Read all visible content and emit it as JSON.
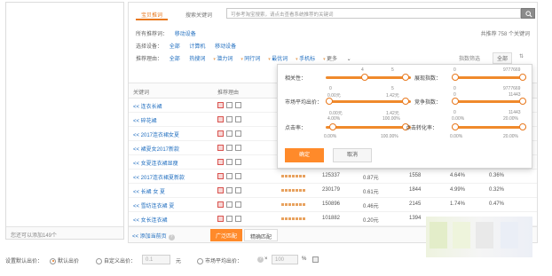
{
  "left_panel": {
    "footer": "您还可以添加149个"
  },
  "tabs": [
    {
      "label": "宝贝推词",
      "active": true
    },
    {
      "label": "搜索关键词",
      "active": false
    }
  ],
  "search": {
    "placeholder": "可参考淘宝搜索，请点击查看系统推荐的关键词"
  },
  "filters": {
    "recommend_label": "所有推荐词：",
    "recommend_items": [
      "移动设备"
    ],
    "device_label": "选择设备：",
    "device_items": [
      "全部",
      "计算机",
      "移动设备"
    ],
    "reason_label": "推荐理由：",
    "reason_items": [
      "全部",
      "热搜词",
      "潜力词",
      "同行词",
      "最优词",
      "手机标"
    ],
    "more": "更多",
    "index_filter": "指数筛选",
    "all": "全部"
  },
  "total_text": "共推荐 758 个关键词",
  "table": {
    "headers": [
      "关键词",
      "推荐理由"
    ],
    "rows": [
      {
        "kw": "<< 连衣长裙",
        "c1": "",
        "c2": "",
        "c3": "",
        "c4": "",
        "c5": ""
      },
      {
        "kw": "<< 碎花裙",
        "c1": "",
        "c2": "",
        "c3": "",
        "c4": "",
        "c5": ""
      },
      {
        "kw": "<< 2017连衣裙女夏",
        "c1": "",
        "c2": "",
        "c3": "",
        "c4": "",
        "c5": ""
      },
      {
        "kw": "<< 裙夏女2017新款",
        "c1": "",
        "c2": "",
        "c3": "",
        "c4": "",
        "c5": ""
      },
      {
        "kw": "<< 女夏连衣裙显瘦",
        "c1": "",
        "c2": "",
        "c3": "",
        "c4": "",
        "c5": ""
      },
      {
        "kw": "<< 2017连衣裙夏新款",
        "c1": "125337",
        "c2": "0.87元",
        "c3": "1558",
        "c4": "4.64%",
        "c5": "0.36%"
      },
      {
        "kw": "<< 长裙 女 夏",
        "c1": "230179",
        "c2": "0.61元",
        "c3": "1844",
        "c4": "4.99%",
        "c5": "0.32%"
      },
      {
        "kw": "<< 雪纺连衣裙 夏",
        "c1": "150896",
        "c2": "0.46元",
        "c3": "2145",
        "c4": "1.74%",
        "c5": "0.47%"
      },
      {
        "kw": "<< 女长连衣裙",
        "c1": "101882",
        "c2": "0.20元",
        "c3": "1394",
        "c4": "",
        "c5": ""
      }
    ]
  },
  "main_bottom": {
    "add_link": "<< 添加当前页",
    "match_tabs": [
      "广泛匹配",
      "精确匹配"
    ]
  },
  "popup": {
    "relevance": {
      "label": "相关性：",
      "min": "4",
      "max": "5"
    },
    "show_index": {
      "label": "展现指数：",
      "min": "0",
      "max": "9777669"
    },
    "avg_bid": {
      "label": "市场平均出价：",
      "min_top": "0",
      "max_top": "5",
      "min": "0.00元",
      "max": "1.42元"
    },
    "competition": {
      "label": "竞争指数：",
      "min_top": "0",
      "max_top": "9777669",
      "min": "0",
      "max": "11443"
    },
    "ctr": {
      "label": "点击率：",
      "min_top": "0.00元",
      "max_top": "1.42元",
      "min_mid": "4.00%",
      "max_mid": "100.00%",
      "min": "0.00%",
      "max": "100.00%"
    },
    "cvr": {
      "label": "点击转化率：",
      "min_top": "0",
      "max_top": "11443",
      "min_mid": "0.00%",
      "max_mid": "20.00%",
      "min": "0.00%",
      "max": "20.00%"
    },
    "ok": "确定",
    "cancel": "取消"
  },
  "bottom_bar": {
    "label": "设置默认出价：",
    "opt1": "默认出价",
    "opt2": "自定义出价：",
    "input1": "0.1",
    "unit1": "元",
    "opt3": "市场平均出价：",
    "times": "×",
    "input2": "100",
    "percent": "%"
  },
  "colors": {
    "accent": "#e8791f",
    "link": "#1f6dbf",
    "button": "#ff8a2a"
  }
}
